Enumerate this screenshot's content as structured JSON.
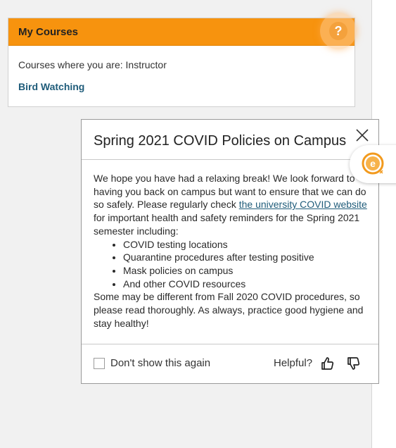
{
  "my_courses": {
    "title": "My Courses",
    "role_text": "Courses where you are: Instructor",
    "courses": [
      {
        "label": "Bird Watching"
      }
    ]
  },
  "help_button": {
    "icon": "question-icon",
    "glyph": "?"
  },
  "popup": {
    "title": "Spring 2021 COVID Policies on Campus",
    "intro_before_link": "We hope you have had a relaxing break! We look forward to having you back on campus but want to ensure that we can do so safely. Please regularly check ",
    "link_text": "the university COVID website",
    "intro_after_link": " for important health and safety reminders for the Spring 2021 semester including:",
    "list_items": [
      "COVID testing locations",
      "Quarantine procedures after testing positive",
      "Mask policies on campus",
      "And other COVID resources"
    ],
    "closing": "Some may be different from Fall 2020 COVID procedures, so please read thoroughly. As always, practice good hygiene and stay healthy!",
    "dont_show_label": "Don't show this again",
    "dont_show_checked": false,
    "helpful_label": "Helpful?"
  },
  "colors": {
    "accent_orange": "#f7930e",
    "link_blue": "#1f5c7a"
  },
  "side_widget": {
    "icon": "e-badge-icon"
  }
}
